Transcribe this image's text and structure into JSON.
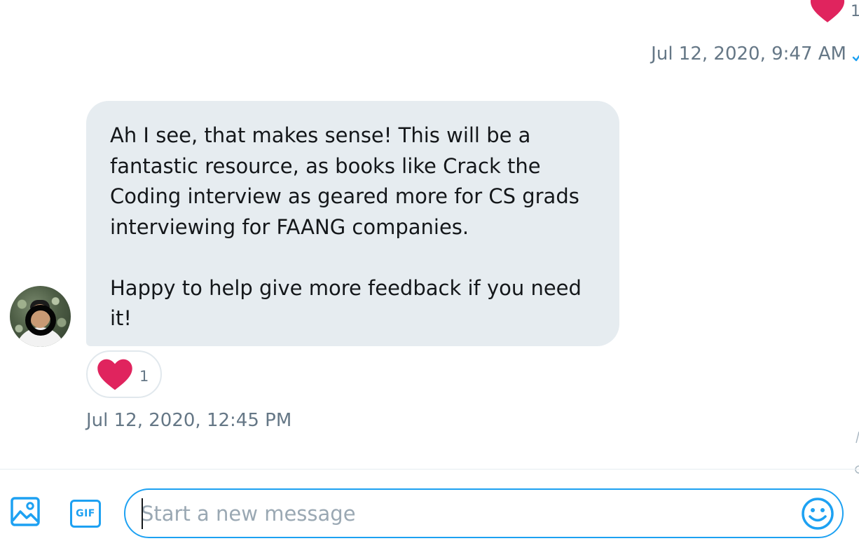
{
  "colors": {
    "accent": "#1da1f2",
    "heart": "#e0245e",
    "bubble_bg": "#e6ecf0",
    "muted_text": "#657786"
  },
  "previous_message": {
    "reaction_icon": "heart-icon",
    "reaction_count": "1",
    "timestamp": "Jul 12, 2020, 9:47 AM",
    "status_icon": "checkmark-icon"
  },
  "received_message": {
    "avatar": "avatar",
    "text": "Ah I see, that makes sense! This will be a\nfantastic resource, as books like Crack the\nCoding interview as geared more for CS grads\ninterviewing for FAANG companies.\n\nHappy to help give more feedback if you need\nit!",
    "reaction_icon": "heart-icon",
    "reaction_count": "1",
    "timestamp": "Jul 12, 2020, 12:45 PM"
  },
  "composer": {
    "media_icon": "image-icon",
    "gif_label": "GIF",
    "placeholder": "Start a new message",
    "value": "",
    "emoji_icon": "smiley-icon"
  }
}
